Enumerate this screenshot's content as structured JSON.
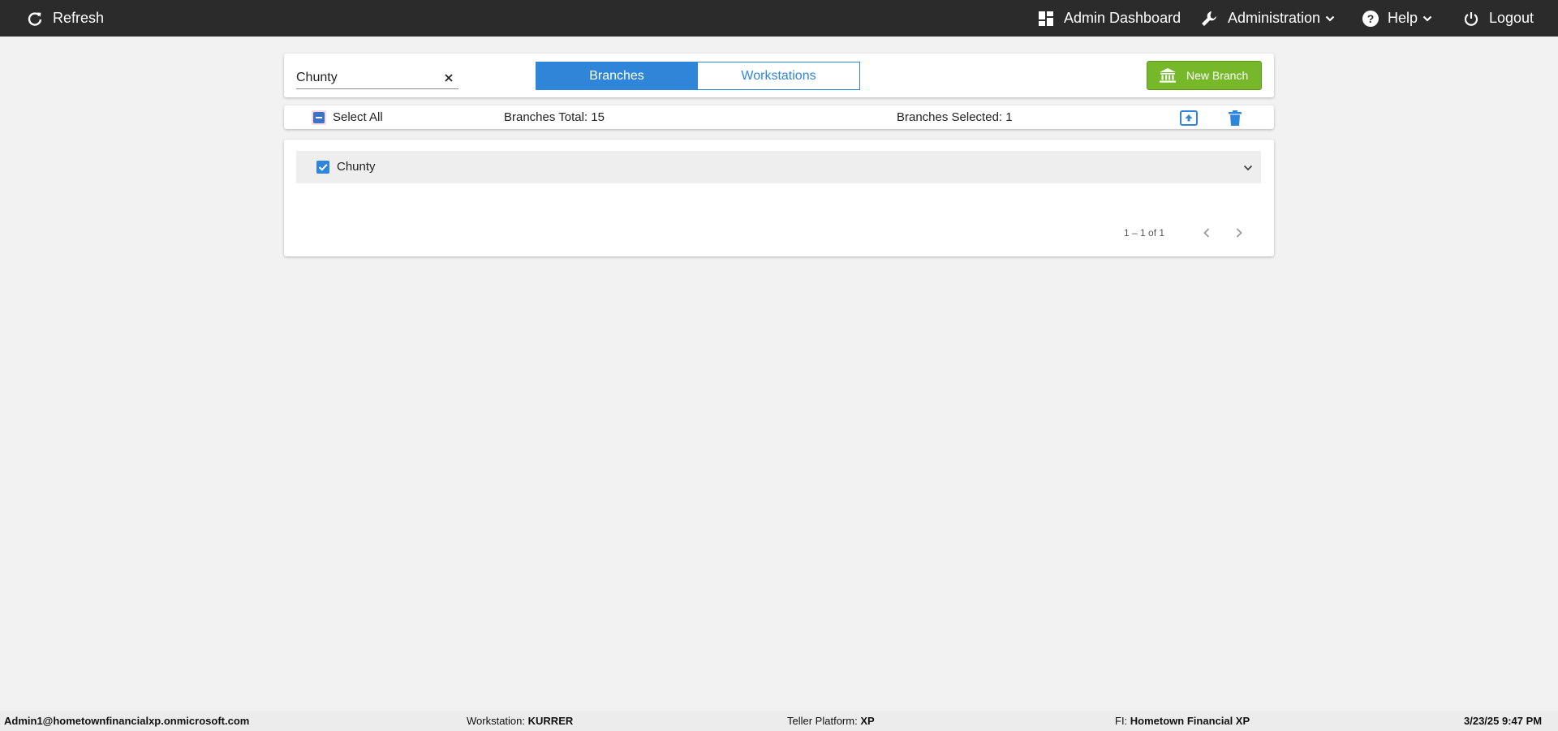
{
  "topbar": {
    "refresh_label": "Refresh",
    "admin_dashboard_label": "Admin Dashboard",
    "administration_label": "Administration",
    "help_label": "Help",
    "logout_label": "Logout"
  },
  "toolbar": {
    "search_value": "Chunty",
    "tabs": [
      {
        "label": "Branches",
        "active": true
      },
      {
        "label": "Workstations",
        "active": false
      }
    ],
    "new_branch_label": "New Branch"
  },
  "selection_bar": {
    "select_all_label": "Select All",
    "total_label": "Branches Total: 15",
    "selected_label": "Branches Selected: 1"
  },
  "results": {
    "rows": [
      {
        "name": "Chunty",
        "checked": true
      }
    ],
    "pager_text": "1 – 1 of 1"
  },
  "footer": {
    "user": "Admin1@hometownfinancialxp.onmicrosoft.com",
    "workstation_label": "Workstation:",
    "workstation_value": "KURRER",
    "platform_label": "Teller Platform:",
    "platform_value": "XP",
    "fi_label": "FI:",
    "fi_value": "Hometown Financial XP",
    "datetime": "3/23/25 9:47 PM"
  },
  "colors": {
    "accent": "#2f86d8",
    "topbar": "#2b2b2b",
    "new_branch": "#76b82a"
  }
}
